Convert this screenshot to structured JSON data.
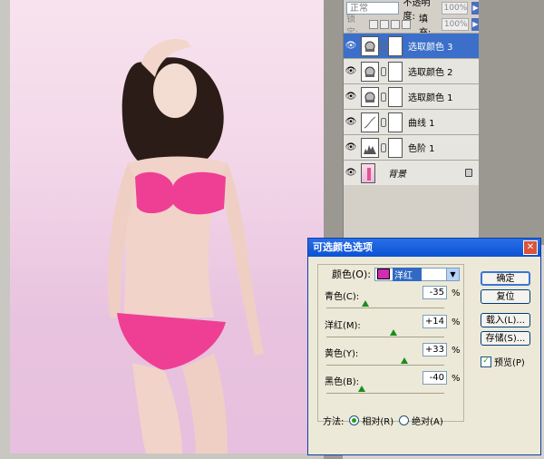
{
  "layers_panel": {
    "blend_mode": "正常",
    "opacity_label": "不透明度:",
    "opacity_value": "100%",
    "lock_label": "锁定:",
    "fill_label": "填充:",
    "fill_value": "100%",
    "layers": [
      {
        "name": "选取颜色 3",
        "icon": "selective-color-icon",
        "selected": true
      },
      {
        "name": "选取颜色 2",
        "icon": "selective-color-icon",
        "selected": false
      },
      {
        "name": "选取颜色 1",
        "icon": "selective-color-icon",
        "selected": false
      },
      {
        "name": "曲线 1",
        "icon": "curves-icon",
        "selected": false
      },
      {
        "name": "色阶 1",
        "icon": "levels-icon",
        "selected": false
      },
      {
        "name": "背景",
        "icon": "background-thumb",
        "selected": false
      }
    ]
  },
  "dialog": {
    "title": "可选颜色选项",
    "colors_label": "颜色(O):",
    "selected_color": "洋红",
    "swatch_color": "#d12cb3",
    "sliders": [
      {
        "label": "青色(C):",
        "value": "-35",
        "fraction": 0.33
      },
      {
        "label": "洋红(M):",
        "value": "+14",
        "fraction": 0.57
      },
      {
        "label": "黄色(Y):",
        "value": "+33",
        "fraction": 0.66
      },
      {
        "label": "黑色(B):",
        "value": "-40",
        "fraction": 0.3
      }
    ],
    "percent_sign": "%",
    "buttons": {
      "ok": "确定",
      "reset": "复位",
      "load": "载入(L)...",
      "save": "存储(S)..."
    },
    "preview_label": "预览(P)",
    "preview_checked": true,
    "method_label": "方法:",
    "method_relative": "相对(R)",
    "method_absolute": "绝对(A)"
  }
}
